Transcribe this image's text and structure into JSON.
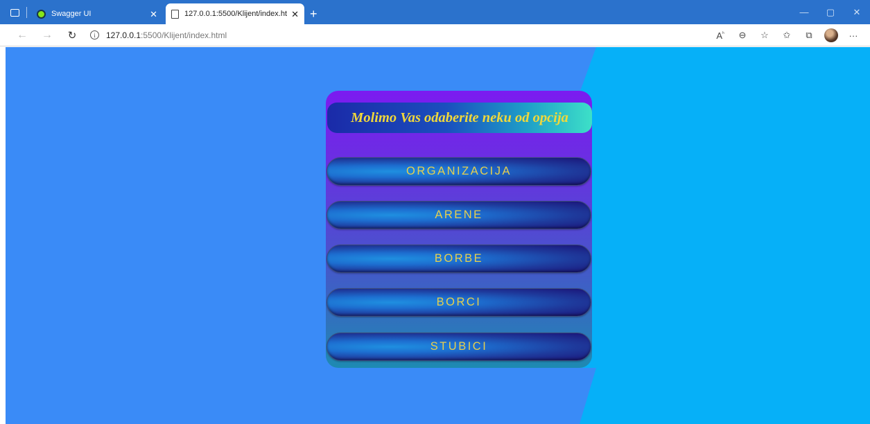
{
  "browser": {
    "tabs": [
      {
        "label": "Swagger UI",
        "active": false
      },
      {
        "label": "127.0.0.1:5500/Klijent/index.html",
        "active": true
      }
    ],
    "address": {
      "host": "127.0.0.1",
      "rest": ":5500/Klijent/index.html"
    }
  },
  "page": {
    "title": "Molimo Vas odaberite neku od opcija",
    "buttons": [
      "ORGANIZACIJA",
      "ARENE",
      "BORBE",
      "BORCI",
      "STUBICI"
    ]
  },
  "colors": {
    "tab_strip": "#2b72cc",
    "page_background_left": "#3a8bf7",
    "page_background_right": "#06b0f8",
    "title_text": "#f1d83a",
    "button_text": "#e7cf4e"
  }
}
